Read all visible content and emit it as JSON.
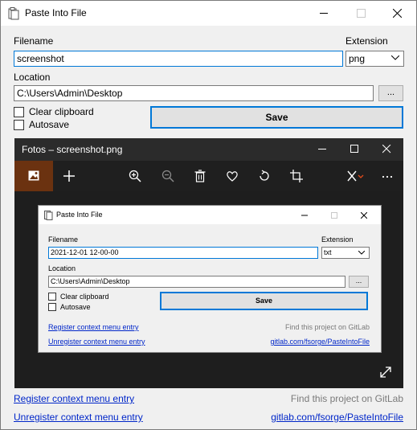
{
  "window": {
    "title": "Paste Into File"
  },
  "form": {
    "filename_label": "Filename",
    "filename_value": "screenshot",
    "extension_label": "Extension",
    "extension_value": "png",
    "location_label": "Location",
    "location_value": "C:\\Users\\Admin\\Desktop",
    "browse_label": "...",
    "clear_clipboard_label": "Clear clipboard",
    "autosave_label": "Autosave",
    "save_label": "Save"
  },
  "footer": {
    "register_link": "Register context menu entry",
    "unregister_link": "Unregister context menu entry",
    "project_text": "Find this project on GitLab",
    "project_link": "gitlab.com/fsorge/PasteIntoFile"
  },
  "preview": {
    "title": "Fotos – screenshot.png",
    "more_label": "...",
    "inner_dialog": {
      "title": "Paste Into File",
      "filename_label": "Filename",
      "filename_value": "2021-12-01 12-00-00",
      "extension_label": "Extension",
      "extension_value": "txt",
      "location_label": "Location",
      "location_value": "C:\\Users\\Admin\\Desktop",
      "browse_label": "...",
      "clear_clipboard_label": "Clear clipboard",
      "autosave_label": "Autosave",
      "save_label": "Save",
      "register_link": "Register context menu entry",
      "unregister_link": "Unregister context menu entry",
      "project_text": "Find this project on GitLab",
      "project_link": "gitlab.com/fsorge/PasteIntoFile"
    }
  },
  "icons": {
    "app": "document-paste-icon",
    "minimize": "minimize-icon",
    "maximize": "maximize-icon",
    "close": "close-icon"
  },
  "colors": {
    "accent": "#0078d7",
    "link": "#0026c9",
    "photos_active": "#6b3210"
  }
}
